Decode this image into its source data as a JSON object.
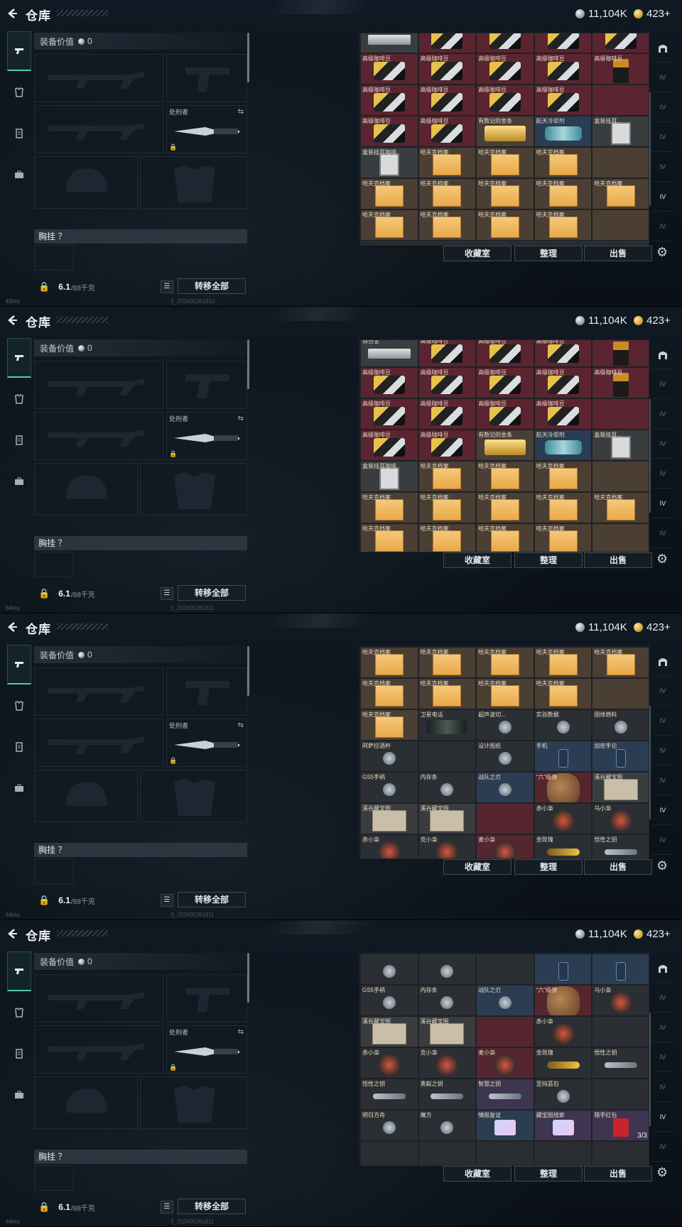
{
  "header": {
    "title": "仓库",
    "currency_silver": "11,104K",
    "currency_gold": "423+"
  },
  "equip": {
    "value_label": "装备价值",
    "value_amount": "0",
    "melee_label": "处刑者",
    "chest_label": "胸挂 ？",
    "weight_current": "6.1",
    "weight_max": "/88千克",
    "transfer_all": "转移全部"
  },
  "buttons": {
    "collection": "收藏室",
    "organize": "整理",
    "sell": "出售"
  },
  "status": [
    "83ms",
    "64ms",
    "64ms",
    "64ms"
  ],
  "uid": [
    "3_202605261810",
    "3_202605261811",
    "3_202605261811",
    "3_202605261811"
  ],
  "colors": {
    "accent": "#4fd1a5",
    "coffee": "#5a2430",
    "file": "#4b3e33",
    "blue": "#2b3d52",
    "purple": "#3e3550"
  },
  "stash": {
    "view1": {
      "rows": [
        [
          [
            "",
            "bg-gray",
            "silver"
          ],
          [
            "",
            "bg-coffee",
            "coffee"
          ],
          [
            "",
            "bg-coffee",
            "coffee"
          ],
          [
            "",
            "bg-coffee",
            "coffee"
          ],
          [
            "",
            "bg-coffee",
            "coffee"
          ]
        ],
        [
          [
            "高级咖啡豆",
            "bg-coffee",
            "coffee"
          ],
          [
            "高级咖啡豆",
            "bg-coffee",
            "coffee"
          ],
          [
            "高级咖啡豆",
            "bg-coffee",
            "coffee"
          ],
          [
            "高级咖啡豆",
            "bg-coffee",
            "coffee"
          ],
          [
            "高级咖啡豆",
            "bg-coffee",
            "bag"
          ]
        ],
        [
          [
            "高级咖啡豆",
            "bg-coffee",
            "coffee"
          ],
          [
            "高级咖啡豆",
            "bg-coffee",
            "coffee"
          ],
          [
            "高级咖啡豆",
            "bg-coffee",
            "coffee"
          ],
          [
            "高级咖啡豆",
            "bg-coffee",
            "coffee"
          ],
          [
            "",
            "bg-coffee",
            ""
          ]
        ],
        [
          [
            "高级咖啡豆",
            "bg-coffee",
            "coffee"
          ],
          [
            "高级咖啡豆",
            "bg-coffee",
            "coffee"
          ],
          [
            "有数记的金条",
            "bg-gold",
            "goldbar"
          ],
          [
            "航天冷却剂",
            "bg-blue",
            "can"
          ],
          [
            "盒装挂耳...",
            "bg-gray",
            "case"
          ]
        ],
        [
          [
            "盒装挂耳咖啡",
            "bg-gray",
            "case"
          ],
          [
            "哈夫克档案",
            "bg-file",
            "file"
          ],
          [
            "哈夫克档案",
            "bg-file",
            "file"
          ],
          [
            "哈夫克档案",
            "bg-file",
            "file"
          ],
          [
            "",
            "bg-file",
            ""
          ]
        ],
        [
          [
            "哈夫克档案",
            "bg-file",
            "file"
          ],
          [
            "哈夫克档案",
            "bg-file",
            "file"
          ],
          [
            "哈夫克档案",
            "bg-file",
            "file"
          ],
          [
            "哈夫克档案",
            "bg-file",
            "file"
          ],
          [
            "哈夫克档案",
            "bg-file",
            "file"
          ]
        ],
        [
          [
            "哈夫克档案",
            "bg-file",
            "file"
          ],
          [
            "哈夫克档案",
            "bg-file",
            "file"
          ],
          [
            "哈夫克档案",
            "bg-file",
            "file"
          ],
          [
            "哈夫克档案",
            "bg-file",
            "file"
          ],
          [
            "",
            "bg-file",
            ""
          ]
        ]
      ]
    },
    "view2": {
      "rows": [
        [
          [
            "铁合金",
            "bg-gray",
            "silver"
          ],
          [
            "高级咖啡豆",
            "bg-coffee",
            "coffee"
          ],
          [
            "高级咖啡豆",
            "bg-coffee",
            "coffee"
          ],
          [
            "高级咖啡豆",
            "bg-coffee",
            "coffee"
          ],
          [
            "",
            "bg-coffee",
            "bag"
          ]
        ],
        [
          [
            "高级咖啡豆",
            "bg-coffee",
            "coffee"
          ],
          [
            "高级咖啡豆",
            "bg-coffee",
            "coffee"
          ],
          [
            "高级咖啡豆",
            "bg-coffee",
            "coffee"
          ],
          [
            "高级咖啡豆",
            "bg-coffee",
            "coffee"
          ],
          [
            "高级咖啡豆",
            "bg-coffee",
            "bag"
          ]
        ],
        [
          [
            "高级咖啡豆",
            "bg-coffee",
            "coffee"
          ],
          [
            "高级咖啡豆",
            "bg-coffee",
            "coffee"
          ],
          [
            "高级咖啡豆",
            "bg-coffee",
            "coffee"
          ],
          [
            "高级咖啡豆",
            "bg-coffee",
            "coffee"
          ],
          [
            "",
            "bg-coffee",
            ""
          ]
        ],
        [
          [
            "高级咖啡豆",
            "bg-coffee",
            "coffee"
          ],
          [
            "高级咖啡豆",
            "bg-coffee",
            "coffee"
          ],
          [
            "有数记的金条",
            "bg-gold",
            "goldbar"
          ],
          [
            "航天冷却剂",
            "bg-blue",
            "can"
          ],
          [
            "盒装挂耳...",
            "bg-gray",
            "case"
          ]
        ],
        [
          [
            "盒装挂耳咖啡",
            "bg-gray",
            "case"
          ],
          [
            "哈夫克档案",
            "bg-file",
            "file"
          ],
          [
            "哈夫克档案",
            "bg-file",
            "file"
          ],
          [
            "哈夫克档案",
            "bg-file",
            "file"
          ],
          [
            "",
            "bg-file",
            ""
          ]
        ],
        [
          [
            "哈夫克档案",
            "bg-file",
            "file"
          ],
          [
            "哈夫克档案",
            "bg-file",
            "file"
          ],
          [
            "哈夫克档案",
            "bg-file",
            "file"
          ],
          [
            "哈夫克档案",
            "bg-file",
            "file"
          ],
          [
            "哈夫克档案",
            "bg-file",
            "file"
          ]
        ],
        [
          [
            "哈夫克档案",
            "bg-file",
            "file"
          ],
          [
            "哈夫克档案",
            "bg-file",
            "file"
          ],
          [
            "哈夫克档案",
            "bg-file",
            "file"
          ],
          [
            "哈夫克档案",
            "bg-file",
            "file"
          ],
          [
            "",
            "bg-file",
            ""
          ]
        ]
      ]
    },
    "view3": {
      "rows": [
        [
          [
            "哈夫克档案",
            "bg-file",
            "file"
          ],
          [
            "哈夫克档案",
            "bg-file",
            "file"
          ],
          [
            "哈夫克档案",
            "bg-file",
            "file"
          ],
          [
            "哈夫克档案",
            "bg-file",
            "file"
          ],
          [
            "哈夫克档案",
            "bg-file",
            "file"
          ]
        ],
        [
          [
            "哈夫克档案",
            "bg-file",
            "file"
          ],
          [
            "哈夫克档案",
            "bg-file",
            "file"
          ],
          [
            "哈夫克档案",
            "bg-file",
            "file"
          ],
          [
            "哈夫克档案",
            "bg-file",
            "file"
          ],
          [
            "",
            "bg-file",
            ""
          ]
        ],
        [
          [
            "哈夫克档案",
            "bg-file",
            "file"
          ],
          [
            "卫星电话",
            "bg-dark",
            "radio"
          ],
          [
            "超声波切...",
            "bg-dark",
            "small"
          ],
          [
            "实验数据",
            "bg-dark",
            "small"
          ],
          [
            "固体燃料",
            "bg-dark",
            "small"
          ]
        ],
        [
          [
            "阿萨拉酒杯",
            "bg-dark",
            "small"
          ],
          [
            "",
            "bg-empty",
            ""
          ],
          [
            "设计图纸",
            "bg-dark",
            "small"
          ],
          [
            "手机",
            "bg-blue",
            "phone"
          ],
          [
            "加密手记",
            "bg-blue",
            "phone"
          ]
        ],
        [
          [
            "GS5手柄",
            "bg-dark",
            "small"
          ],
          [
            "内存条",
            "bg-dark",
            "small"
          ],
          [
            "战队之刃",
            "bg-blue",
            "small"
          ],
          [
            "“六”级弹",
            "bg-red",
            "hand"
          ],
          [
            "溪谷藏宝图",
            "bg-gray",
            "map"
          ]
        ],
        [
          [
            "溪谷藏宝图",
            "bg-gray",
            "map"
          ],
          [
            "溪谷藏宝图",
            "bg-gray",
            "map"
          ],
          [
            "",
            "bg-red",
            ""
          ],
          [
            "赤小枭",
            "bg-dark",
            "doll"
          ],
          [
            "乌小枭",
            "bg-dark",
            "doll"
          ]
        ],
        [
          [
            "赤小枭",
            "bg-dark",
            "doll"
          ],
          [
            "克小枭",
            "bg-dark",
            "doll"
          ],
          [
            "麦小枭",
            "bg-red",
            "doll"
          ],
          [
            "金玫瑰",
            "bg-dark",
            "rose"
          ],
          [
            "悟性之钥",
            "bg-dark",
            "key"
          ]
        ]
      ]
    },
    "view4": {
      "rows": [
        [
          [
            "",
            "bg-dark",
            "small"
          ],
          [
            "",
            "bg-dark",
            "small"
          ],
          [
            "",
            "bg-empty",
            ""
          ],
          [
            "",
            "bg-blue",
            "phone"
          ],
          [
            "",
            "bg-blue",
            "phone"
          ]
        ],
        [
          [
            "GS5手柄",
            "bg-dark",
            "small"
          ],
          [
            "内存条",
            "bg-dark",
            "small"
          ],
          [
            "战队之刃",
            "bg-blue",
            "small"
          ],
          [
            "“六”级弹",
            "bg-red",
            "hand"
          ],
          [
            "乌小枭",
            "bg-dark",
            "doll"
          ]
        ],
        [
          [
            "溪谷藏宝图",
            "bg-gray",
            "map"
          ],
          [
            "溪谷藏宝图",
            "bg-gray",
            "map"
          ],
          [
            "",
            "bg-red",
            ""
          ],
          [
            "赤小枭",
            "bg-dark",
            "doll"
          ],
          [
            "",
            "bg-dark",
            ""
          ]
        ],
        [
          [
            "赤小枭",
            "bg-dark",
            "doll"
          ],
          [
            "克小枭",
            "bg-dark",
            "doll"
          ],
          [
            "麦小枭",
            "bg-red",
            "doll"
          ],
          [
            "金玫瑰",
            "bg-dark",
            "rose"
          ],
          [
            "悟性之钥",
            "bg-dark",
            "key"
          ]
        ],
        [
          [
            "悟性之钥",
            "bg-dark",
            "key"
          ],
          [
            "勇毅之钥",
            "bg-dark",
            "key"
          ],
          [
            "智慧之钥",
            "bg-purple",
            "key"
          ],
          [
            "至纯蓝石",
            "bg-dark",
            "small"
          ],
          [
            "",
            "bg-dark",
            ""
          ]
        ],
        [
          [
            "明日方舟",
            "bg-dark",
            "small"
          ],
          [
            "魔方",
            "bg-dark",
            "small"
          ],
          [
            "情报复证",
            "bg-blue",
            "card"
          ],
          [
            "藏宝图线索",
            "bg-purple",
            "card"
          ],
          [
            "猎手红包",
            "bg-purple",
            "envelope"
          ]
        ],
        [
          [
            "",
            "bg-empty",
            ""
          ],
          [
            "",
            "bg-empty",
            ""
          ],
          [
            "",
            "bg-empty",
            ""
          ],
          [
            "",
            "bg-empty",
            ""
          ],
          [
            "",
            "bg-empty",
            ""
          ]
        ]
      ],
      "last_count": "3/3"
    }
  }
}
